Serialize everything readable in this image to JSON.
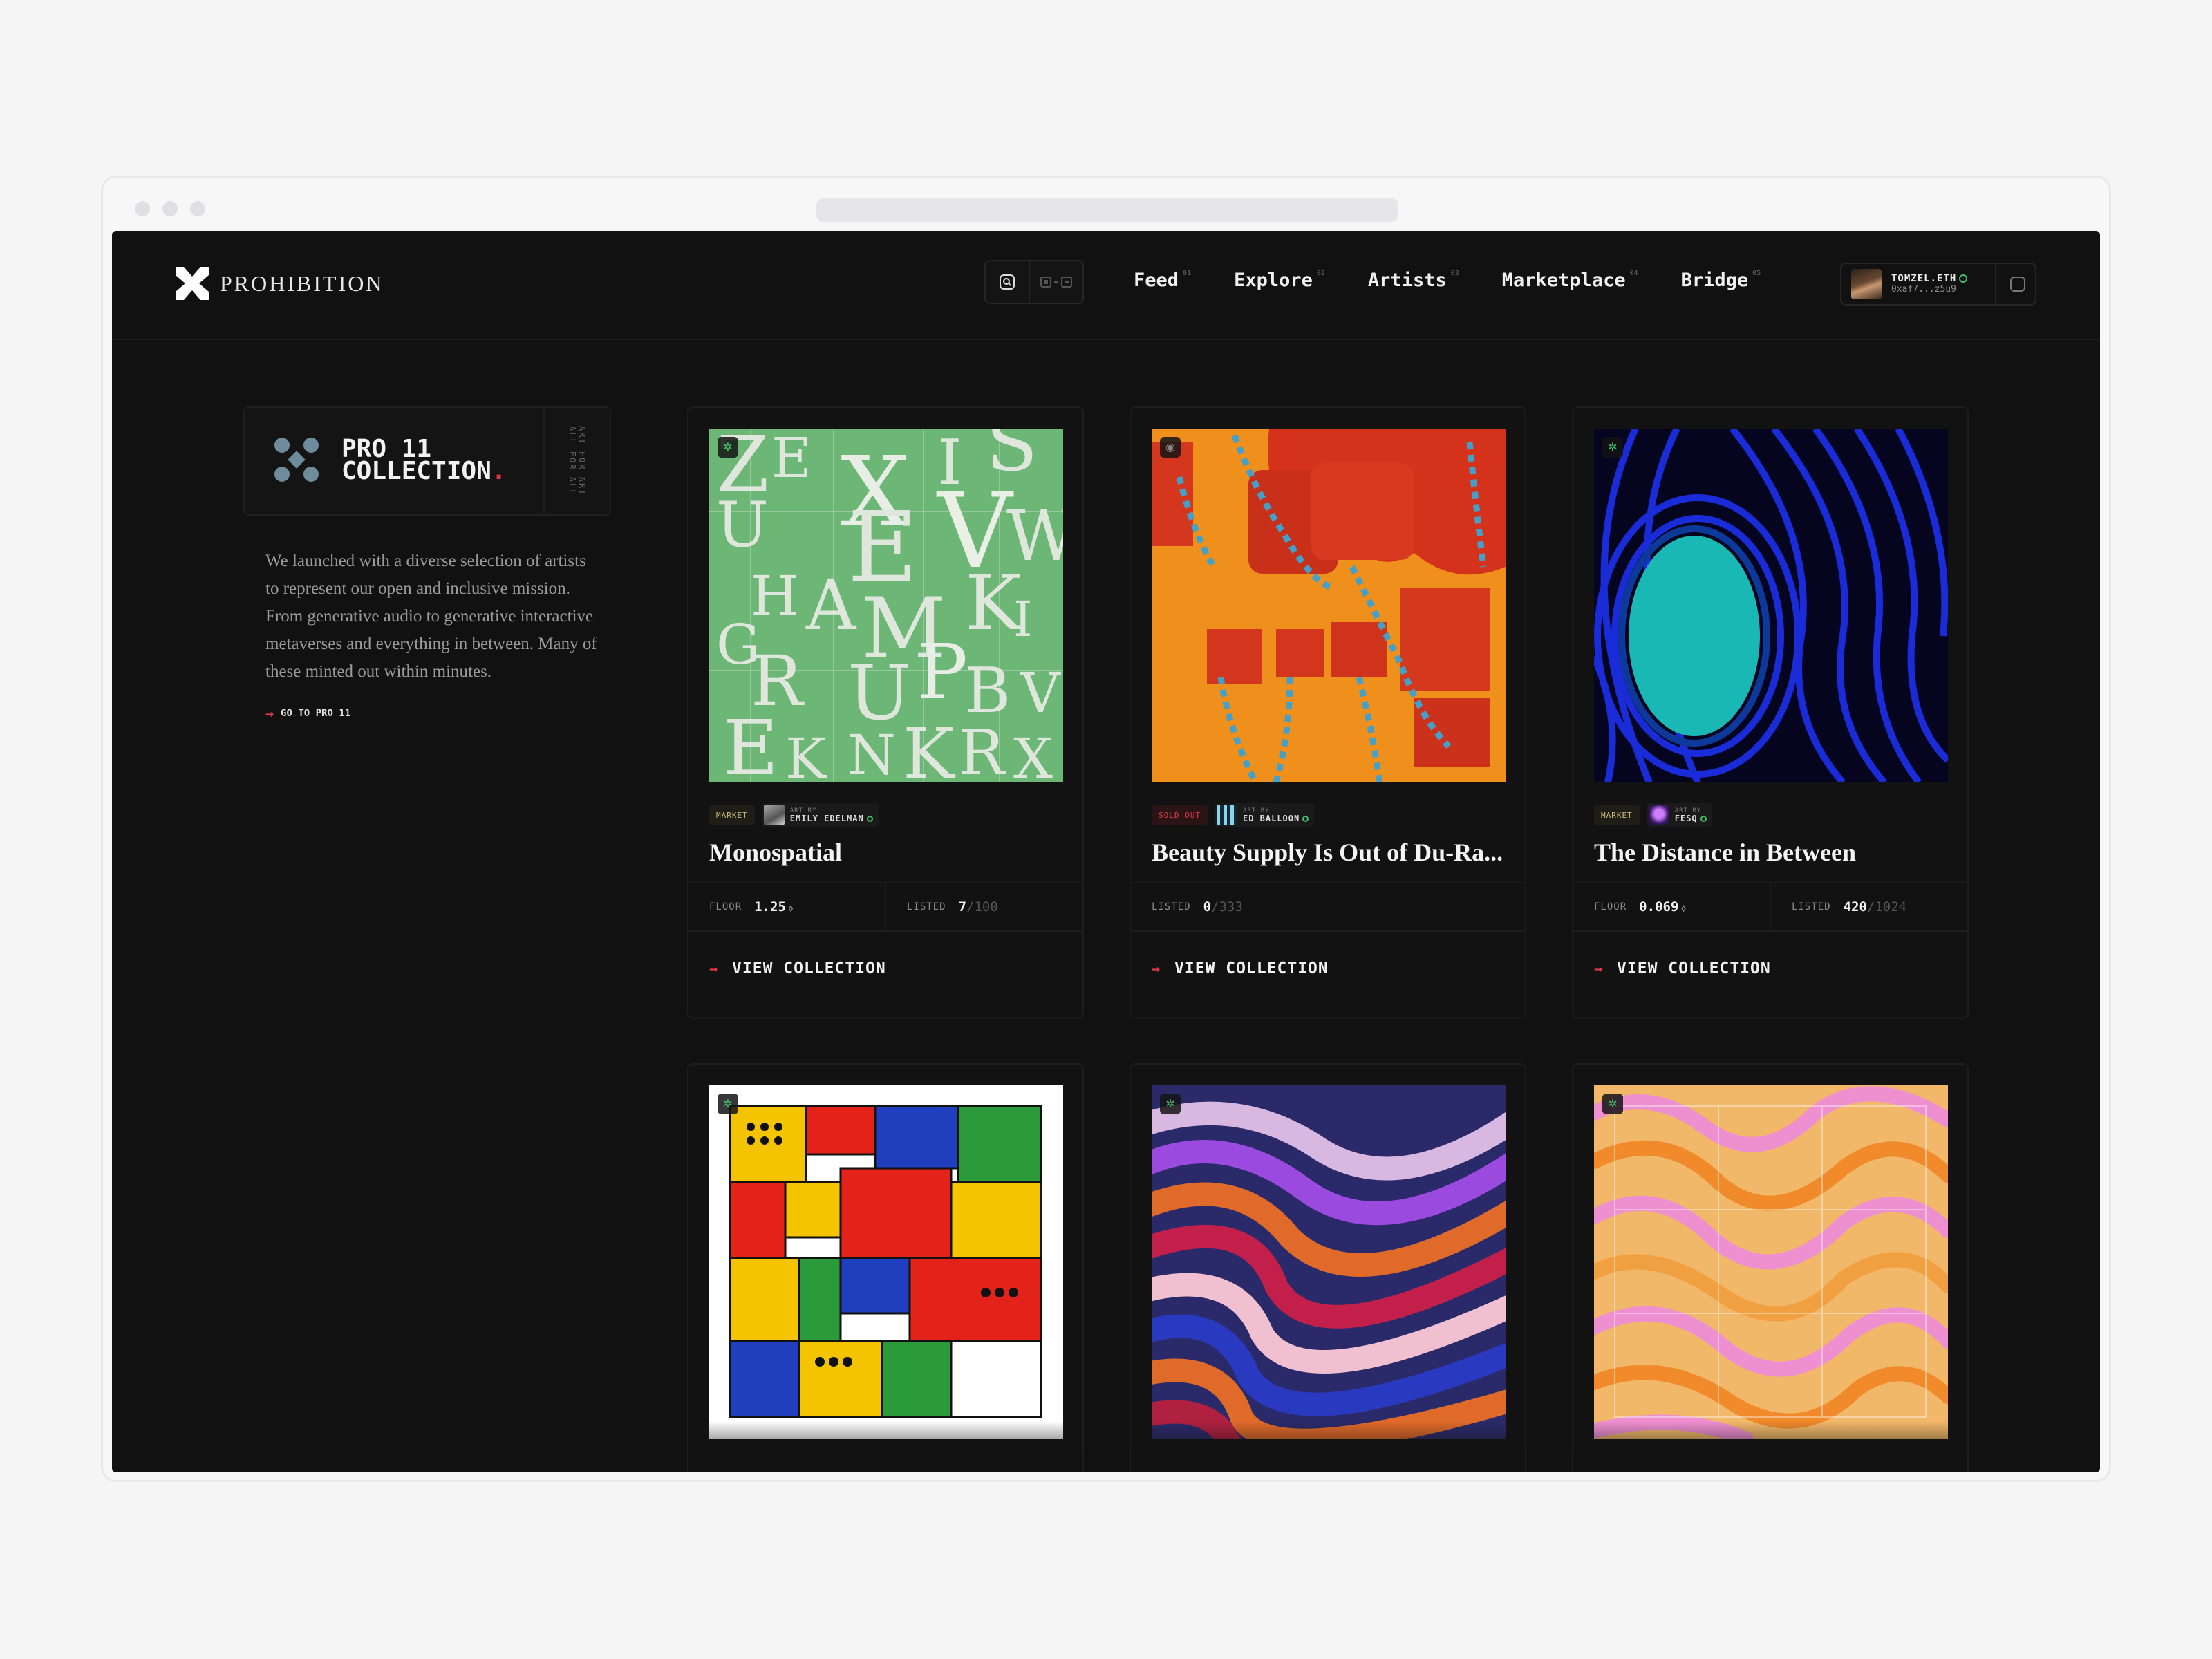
{
  "brand": {
    "name": "PROHIBITION"
  },
  "nav": {
    "items": [
      {
        "label": "Feed",
        "num": "01"
      },
      {
        "label": "Explore",
        "num": "02"
      },
      {
        "label": "Artists",
        "num": "03"
      },
      {
        "label": "Marketplace",
        "num": "04"
      },
      {
        "label": "Bridge",
        "num": "05"
      }
    ]
  },
  "user": {
    "name": "TOMZEL.ETH",
    "address": "0xaf7...z5u9"
  },
  "collection": {
    "title_line1": "PRO 11",
    "title_line2": "COLLECTION",
    "side_text_1": "ALL FOR ALL",
    "side_text_2": "ART FOR ART",
    "description": "We launched with a diverse selection of artists to represent our open and inclusive mission. From generative audio to generative interactive metaverses and everything in between. Many of these minted out within minutes.",
    "goto_label": "GO TO PRO 11"
  },
  "cards": [
    {
      "status": "MARKET",
      "art_by": "ART BY",
      "artist": "EMILY EDELMAN",
      "title": "Monospatial",
      "floor_label": "FLOOR",
      "floor": "1.25",
      "listed_label": "LISTED",
      "listed": "7",
      "listed_total": "/100",
      "cta": "VIEW COLLECTION"
    },
    {
      "status": "SOLD OUT",
      "art_by": "ART BY",
      "artist": "ED BALLOON",
      "title": "Beauty Supply Is Out of Du-Ra...",
      "listed_label": "LISTED",
      "listed": "0",
      "listed_total": "/333",
      "cta": "VIEW COLLECTION"
    },
    {
      "status": "MARKET",
      "art_by": "ART BY",
      "artist": "FESQ",
      "title": "The Distance in Between",
      "floor_label": "FLOOR",
      "floor": "0.069",
      "listed_label": "LISTED",
      "listed": "420",
      "listed_total": "/1024",
      "cta": "VIEW COLLECTION"
    }
  ],
  "icons": {
    "logo": "prohibition-logo-icon",
    "search": "search-icon",
    "grid_toggle": "grid-toggle-icon",
    "arrow": "arrow-right-icon",
    "verified": "verified-icon"
  },
  "colors": {
    "accent": "#e5374a",
    "background": "#111111",
    "market_tag": "#c9b97a",
    "verified": "#3fbf6a"
  }
}
